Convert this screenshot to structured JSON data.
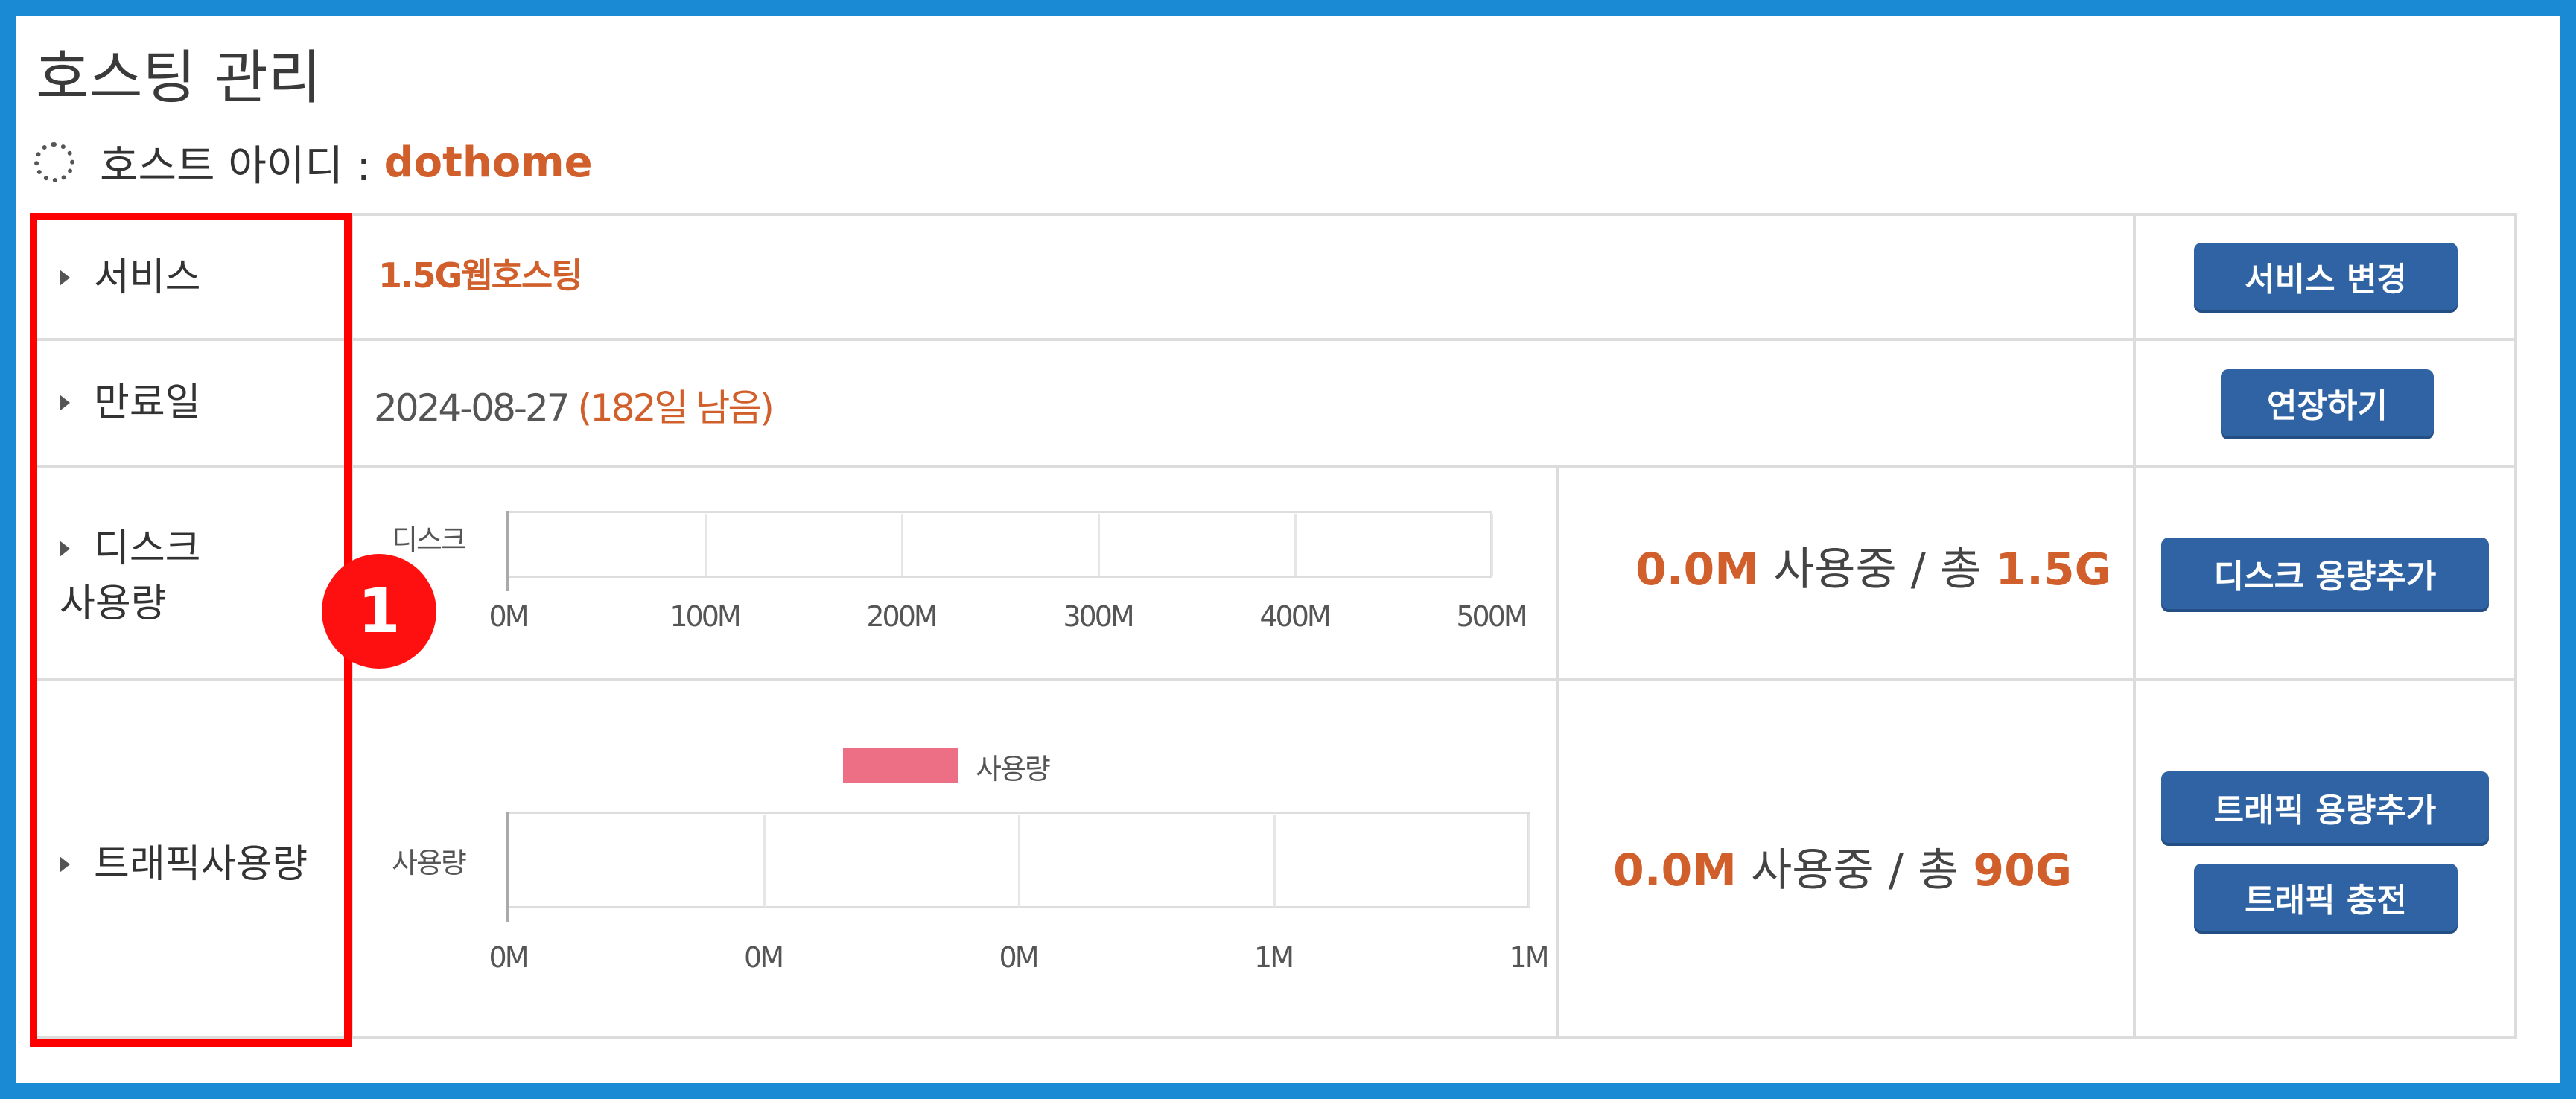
{
  "header": {
    "title": "호스팅 관리",
    "host_id_label": "호스트 아이디 :",
    "host_id_value": "dothome"
  },
  "rows": {
    "service": {
      "label": "서비스",
      "value": "1.5G웹호스팅",
      "button": "서비스 변경"
    },
    "expiry": {
      "label": "만료일",
      "date": "2024-08-27",
      "remaining": "(182일 남음)",
      "button": "연장하기"
    },
    "disk": {
      "label_line1": "디스크",
      "label_line2": "사용량",
      "used": "0.0M",
      "used_text": "사용중 / 총",
      "total": "1.5G",
      "button": "디스크 용량추가"
    },
    "traffic": {
      "label": "트래픽사용량",
      "used": "0.0M",
      "used_text": "사용중 / 총",
      "total": "90G",
      "button_add": "트래픽 용량추가",
      "button_charge": "트래픽 충전"
    }
  },
  "chart_data": [
    {
      "type": "bar",
      "orientation": "horizontal",
      "categories": [
        "디스크"
      ],
      "values": [
        0
      ],
      "xlim": [
        0,
        500
      ],
      "x_ticks": [
        "0M",
        "100M",
        "200M",
        "300M",
        "400M",
        "500M"
      ],
      "grid": true
    },
    {
      "type": "bar",
      "orientation": "horizontal",
      "categories": [
        "사용량"
      ],
      "series": [
        {
          "name": "사용량",
          "values": [
            0
          ],
          "color": "#ec6f85"
        }
      ],
      "x_ticks": [
        "0M",
        "0M",
        "0M",
        "1M",
        "1M"
      ],
      "legend": "top",
      "grid": true
    }
  ],
  "annotation": {
    "badge": "1",
    "color": "#ff0000"
  }
}
